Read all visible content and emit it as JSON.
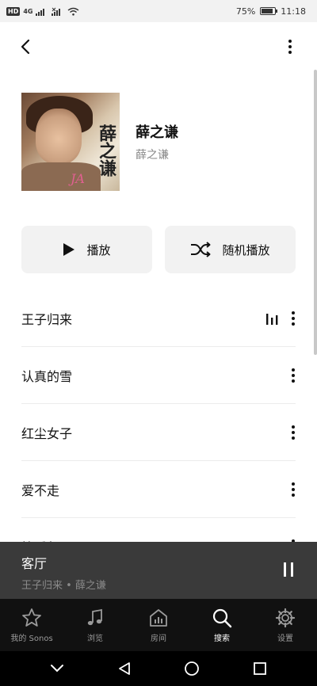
{
  "status_bar": {
    "network_chip": "HD",
    "network_type": "4G",
    "battery_percent": "75%",
    "battery_level": 0.75,
    "time": "11:18"
  },
  "appbar": {
    "back_icon": "back-arrow-icon",
    "more_icon": "more-vertical-icon"
  },
  "artist": {
    "name": "薛之谦",
    "subtitle": "薛之谦",
    "cover_text": "薛之谦",
    "cover_signature": "JA"
  },
  "actions": {
    "play_label": "播放",
    "shuffle_label": "随机播放"
  },
  "tracks": [
    {
      "title": "王子归来",
      "now_playing": true
    },
    {
      "title": "认真的雪",
      "now_playing": false
    },
    {
      "title": "红尘女子",
      "now_playing": false
    },
    {
      "title": "爱不走",
      "now_playing": false
    },
    {
      "title": "快乐帮",
      "now_playing": false
    }
  ],
  "mini_player": {
    "room": "客厅",
    "now_playing": "王子归来 • 薛之谦"
  },
  "bottom_nav": [
    {
      "label": "我的 Sonos",
      "icon": "star-icon",
      "active": false
    },
    {
      "label": "浏览",
      "icon": "music-note-icon",
      "active": false
    },
    {
      "label": "房间",
      "icon": "rooms-icon",
      "active": false
    },
    {
      "label": "搜索",
      "icon": "search-icon",
      "active": true
    },
    {
      "label": "设置",
      "icon": "gear-icon",
      "active": false
    }
  ],
  "colors": {
    "mini_player_bg": "#3a3a3a",
    "nav_bg": "#111111",
    "button_bg": "#f2f2f2"
  }
}
